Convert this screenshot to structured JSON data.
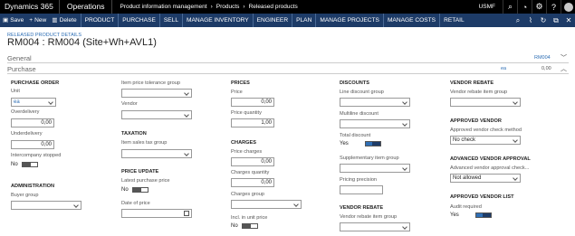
{
  "topbar": {
    "app_name": "Dynamics 365",
    "module": "Operations",
    "breadcrumb": [
      "Product information management",
      "Products",
      "Released products"
    ],
    "company": "USMF"
  },
  "actionbar": {
    "save": "Save",
    "new": "New",
    "delete": "Delete",
    "tabs": [
      "PRODUCT",
      "PURCHASE",
      "SELL",
      "MANAGE INVENTORY",
      "ENGINEER",
      "PLAN",
      "MANAGE PROJECTS",
      "MANAGE COSTS",
      "RETAIL"
    ]
  },
  "page": {
    "caption": "RELEASED PRODUCT DETAILS",
    "title": "RM004 : RM004 (Site+Wh+AVL1)"
  },
  "fasttabs": {
    "general": {
      "label": "General",
      "summary": "RM004"
    },
    "purchase": {
      "label": "Purchase",
      "summary1": "ea",
      "summary2": "0,00"
    }
  },
  "purchase_order": {
    "header": "PURCHASE ORDER",
    "unit_label": "Unit",
    "unit_value": "ea",
    "overdelivery_label": "Overdelivery",
    "overdelivery_value": "0,00",
    "underdelivery_label": "Underdelivery",
    "underdelivery_value": "0,00",
    "intercompany_label": "Intercompany stopped",
    "intercompany_value": "No"
  },
  "administration": {
    "header": "ADMINISTRATION",
    "buyer_group_label": "Buyer group",
    "buyer_group_value": ""
  },
  "tolerance": {
    "item_price_tolerance_label": "Item price tolerance group",
    "item_price_tolerance_value": "",
    "vendor_label": "Vendor",
    "vendor_value": ""
  },
  "taxation": {
    "header": "TAXATION",
    "item_sales_tax_label": "Item sales tax group",
    "item_sales_tax_value": ""
  },
  "price_update": {
    "header": "PRICE UPDATE",
    "latest_price_label": "Latest purchase price",
    "latest_price_value": "No",
    "date_of_price_label": "Date of price",
    "date_of_price_value": ""
  },
  "prices": {
    "header": "PRICES",
    "price_label": "Price",
    "price_value": "0,00",
    "price_qty_label": "Price quantity",
    "price_qty_value": "1,00"
  },
  "charges": {
    "header": "CHARGES",
    "price_charges_label": "Price charges",
    "price_charges_value": "0,00",
    "charges_qty_label": "Charges quantity",
    "charges_qty_value": "0,00",
    "charges_group_label": "Charges group",
    "charges_group_value": "",
    "incl_label": "Incl. in unit price",
    "incl_value": "No"
  },
  "discounts": {
    "header": "DISCOUNTS",
    "line_discount_label": "Line discount group",
    "line_discount_value": "",
    "multiline_label": "Multiline discount",
    "multiline_value": "",
    "total_discount_label": "Total discount",
    "total_discount_value": "Yes",
    "supplementary_label": "Supplementary item group",
    "supplementary_value": "",
    "pricing_precision_label": "Pricing precision",
    "pricing_precision_value": ""
  },
  "vendor_rebate_mid": {
    "header": "VENDOR REBATE",
    "group_label": "Vendor rebate item group",
    "group_value": ""
  },
  "vendor_rebate_right": {
    "header": "VENDOR REBATE",
    "group_label": "Vendor rebate item group",
    "group_value": ""
  },
  "approved_vendor": {
    "header": "APPROVED VENDOR",
    "method_label": "Approved vendor check method",
    "method_value": "No check"
  },
  "advanced_approval": {
    "header": "ADVANCED VENDOR APPROVAL",
    "check_label": "Advanced vendor approval check...",
    "check_value": "Not allowed"
  },
  "approved_list": {
    "header": "APPROVED VENDOR LIST",
    "audit_label": "Audit required",
    "audit_value": "Yes"
  },
  "colors": {
    "nav": "#1d3b67",
    "accent": "#2f6fb5",
    "topbar": "#000000"
  }
}
